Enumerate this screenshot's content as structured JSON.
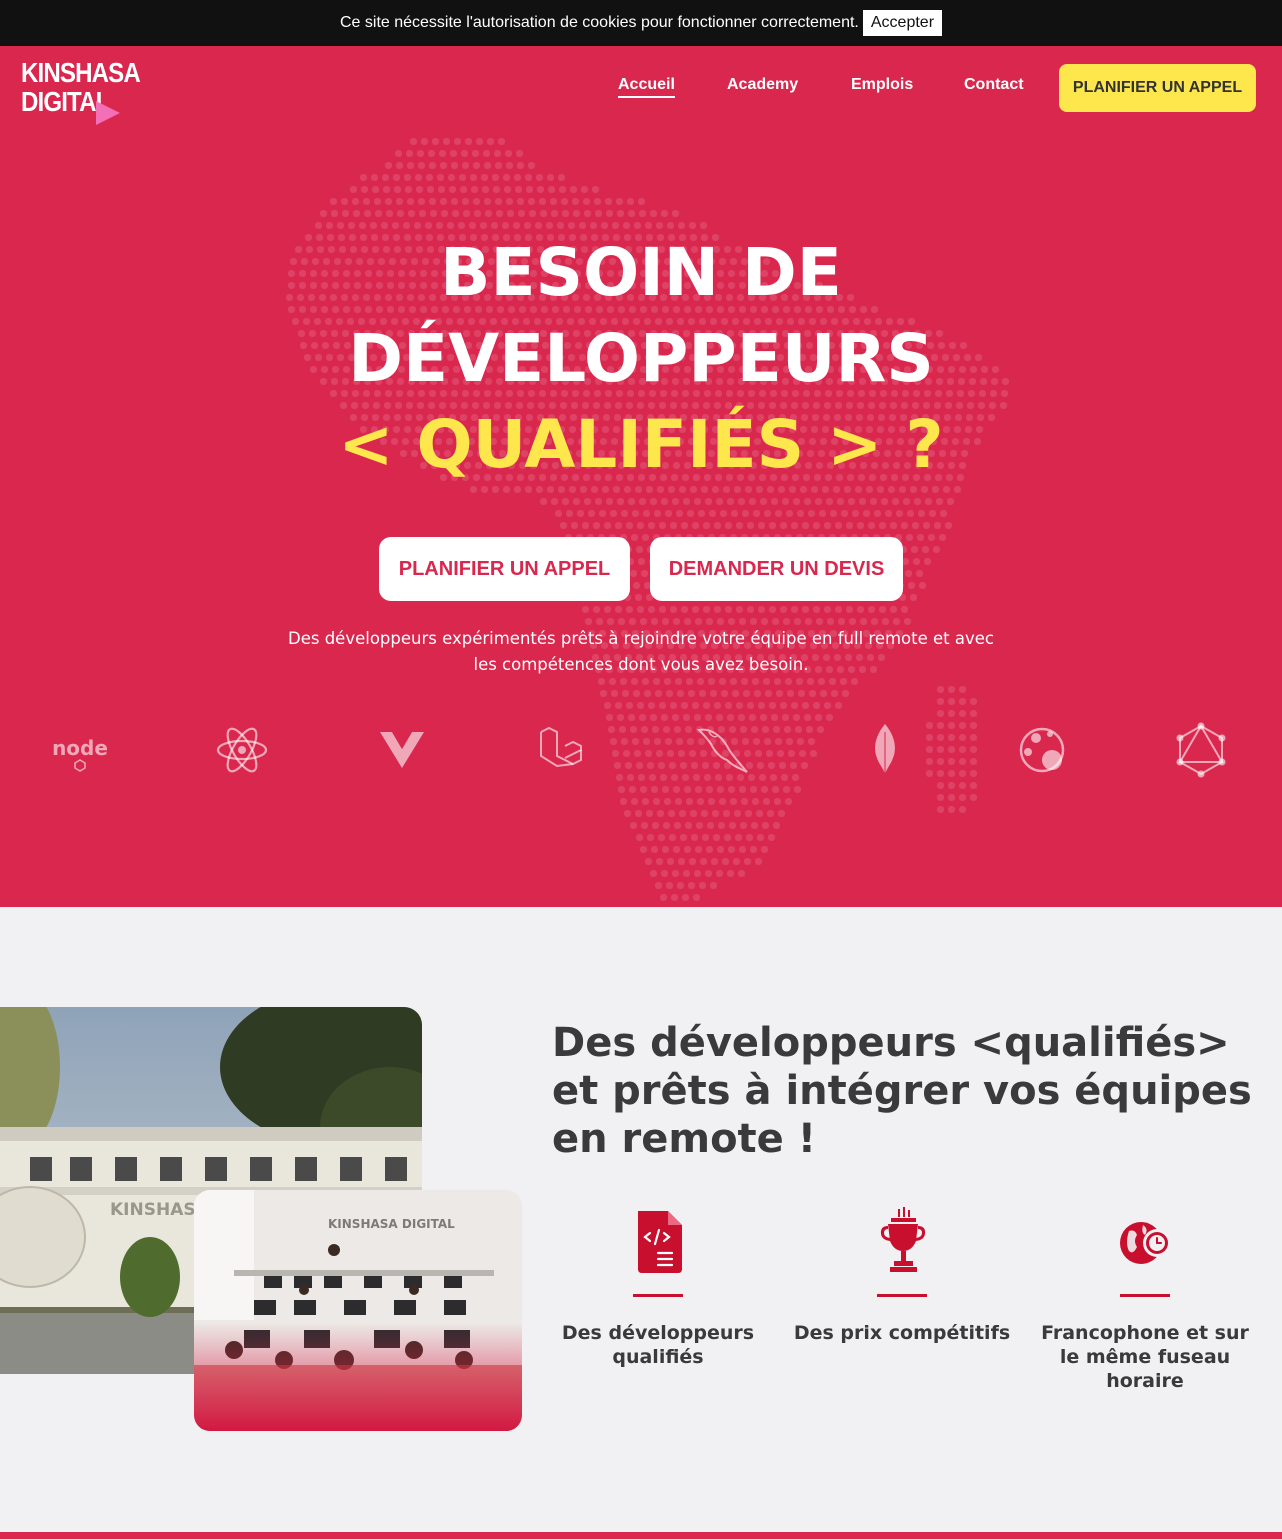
{
  "cookie": {
    "text": "Ce site nécessite l'autorisation de cookies pour fonctionner correctement.",
    "accept_label": "Accepter"
  },
  "brand": {
    "line1": "KINSHASA",
    "line2": "DIGITAL"
  },
  "nav": {
    "items": [
      {
        "label": "Accueil",
        "active": true
      },
      {
        "label": "Academy",
        "active": false
      },
      {
        "label": "Emplois",
        "active": false
      },
      {
        "label": "Contact",
        "active": false
      }
    ],
    "cta_label": "PLANIFIER UN APPEL"
  },
  "hero": {
    "title_line1": "BESOIN DE",
    "title_line2": "DÉVELOPPEURS",
    "title_line3": "< QUALIFIÉS > ?",
    "primary_button": "PLANIFIER UN APPEL",
    "secondary_button": "DEMANDER UN DEVIS",
    "subtitle": "Des développeurs expérimentés prêts à rejoindre votre équipe en full remote et avec les compétences dont vous avez besoin.",
    "technologies": [
      "nodejs-icon",
      "react-icon",
      "vue-icon",
      "laravel-icon",
      "mysql-icon",
      "mongodb-icon",
      "socketio-icon",
      "graphql-icon"
    ]
  },
  "section2": {
    "title": "Des développeurs <qualifiés> et prêts à intégrer vos équipes en remote !",
    "features": [
      {
        "icon": "code-file-icon",
        "label": "Des développeurs qualifiés"
      },
      {
        "icon": "trophy-icon",
        "label": "Des prix compétitifs"
      },
      {
        "icon": "globe-clock-icon",
        "label": "Francophone et sur le même fuseau horaire"
      }
    ]
  },
  "colors": {
    "brand_red": "#d9274e",
    "accent_yellow": "#fde74c",
    "dark_text": "#3a3a3c",
    "icon_red": "#c8102e"
  }
}
